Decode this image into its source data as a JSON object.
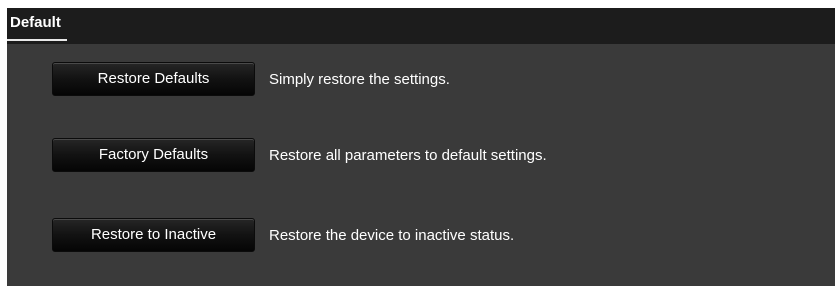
{
  "tab": {
    "label": "Default"
  },
  "options": [
    {
      "button_label": "Restore Defaults",
      "description": "Simply restore the settings."
    },
    {
      "button_label": "Factory Defaults",
      "description": "Restore all parameters to default settings."
    },
    {
      "button_label": "Restore to Inactive",
      "description": "Restore the device to inactive status."
    }
  ],
  "colors": {
    "panel_background": "#3a3a3a",
    "tab_bar_background": "#1c1c1c",
    "button_background": "#121212",
    "text": "#ffffff"
  }
}
